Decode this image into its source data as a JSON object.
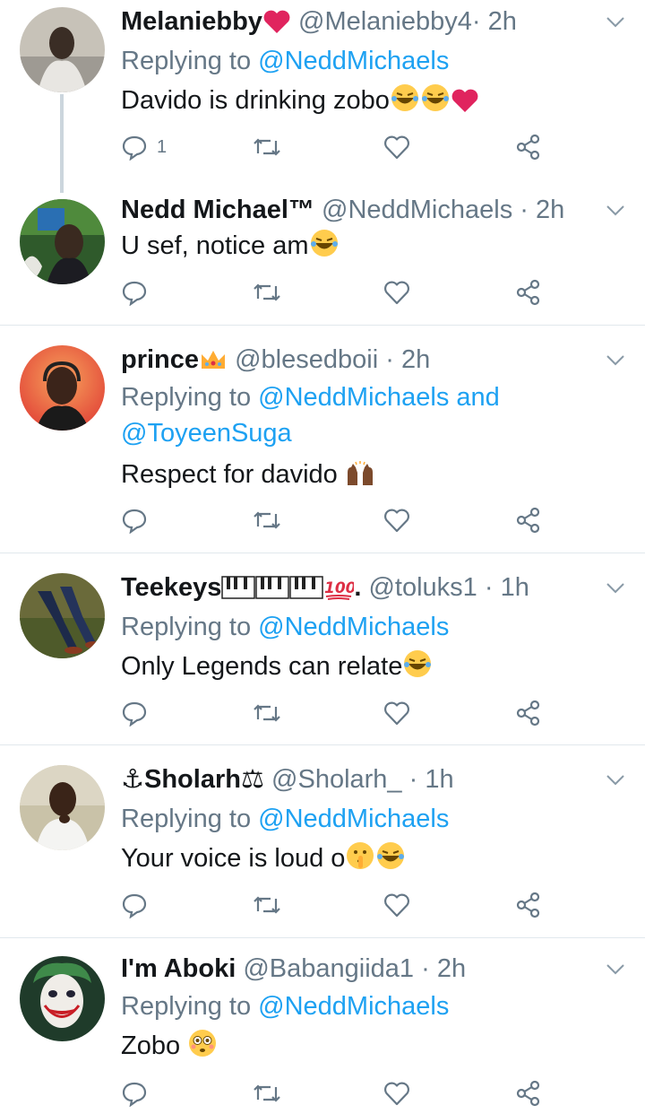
{
  "tweets": [
    {
      "name": "Melaniebby",
      "name_emoji": "heart",
      "handle": "@Melaniebby4",
      "dot": "·",
      "time": "2h",
      "replying_label": "Replying to",
      "mention": "@NeddMichaels",
      "text": "Davido is drinking zobo",
      "reply_count": "1",
      "avatar_color": "#c7c2b8"
    },
    {
      "name": "Nedd Michael™",
      "handle": "@NeddMichaels",
      "dot": "·",
      "time": "2h",
      "text": "U sef, notice am",
      "avatar_color": "#2f5a2b"
    },
    {
      "name": "prince",
      "name_emoji": "crown",
      "handle": "@blesedboii",
      "dot": "·",
      "time": "2h",
      "replying_label": "Replying to",
      "mention": "@NeddMichaels and",
      "mention2": "@ToyeenSuga",
      "text": "Respect for davido",
      "avatar_color": "#e6683a"
    },
    {
      "name": "Teekeys",
      "name_suffix": ".",
      "handle": "@toluks1",
      "dot": "·",
      "time": "1h",
      "replying_label": "Replying to",
      "mention": "@NeddMichaels",
      "text": "Only Legends can relate",
      "avatar_color": "#6a6a3a"
    },
    {
      "name": "Sholarh",
      "name_prefix": "⚓",
      "name_suffix": "⚖",
      "handle": "@Sholarh_",
      "dot": "·",
      "time": "1h",
      "replying_label": "Replying to",
      "mention": "@NeddMichaels",
      "text": "Your voice is loud o",
      "avatar_color": "#c9c2a8"
    },
    {
      "name": "I'm Aboki",
      "handle": "@Babangiida1",
      "dot": "·",
      "time": "2h",
      "replying_label": "Replying to",
      "mention": "@NeddMichaels",
      "text": "Zobo",
      "avatar_color": "#1f3b2a"
    }
  ],
  "colors": {
    "accent": "#1da1f2",
    "secondary_text": "#657786",
    "divider": "#e1e8ed",
    "heart": "#e0245e"
  },
  "icons": [
    "reply-icon",
    "retweet-icon",
    "like-icon",
    "share-icon",
    "chevron-down-icon"
  ]
}
